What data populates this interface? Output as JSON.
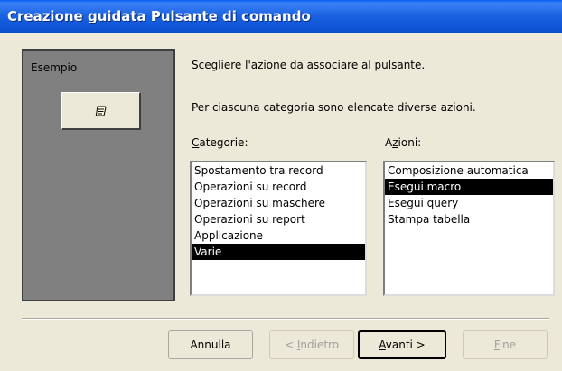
{
  "window": {
    "title": "Creazione guidata Pulsante di comando"
  },
  "preview": {
    "label": "Esempio",
    "button_icon": "macro-scroll-icon"
  },
  "instructions": {
    "line1": "Scegliere l'azione da associare al pulsante.",
    "line2": "Per ciascuna categoria sono elencate diverse azioni."
  },
  "categories": {
    "label_prefix": "",
    "label_underlined": "C",
    "label_rest": "ategorie:",
    "items": [
      "Spostamento tra record",
      "Operazioni su record",
      "Operazioni su maschere",
      "Operazioni su report",
      "Applicazione",
      "Varie"
    ],
    "selected": "Varie"
  },
  "actions": {
    "label_prefix": "A",
    "label_underlined": "z",
    "label_rest": "ioni:",
    "items": [
      "Composizione automatica",
      "Esegui macro",
      "Esegui query",
      "Stampa tabella"
    ],
    "selected": "Esegui macro"
  },
  "buttons": {
    "cancel": "Annulla",
    "back_prefix": "< ",
    "back_underlined": "I",
    "back_rest": "ndietro",
    "next_underlined": "A",
    "next_rest": "vanti >",
    "finish_underlined": "F",
    "finish_rest": "ine"
  }
}
